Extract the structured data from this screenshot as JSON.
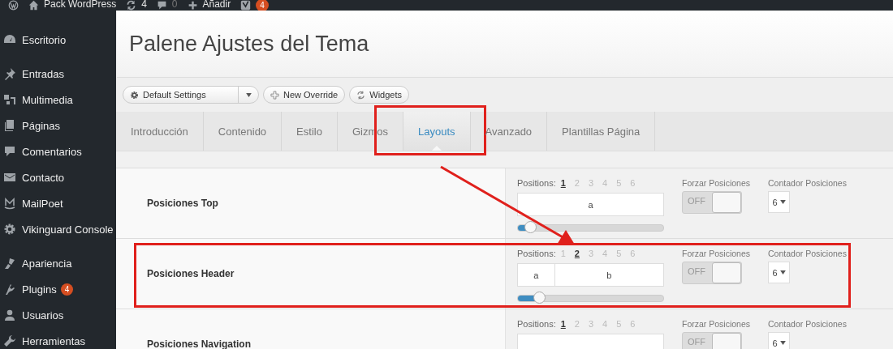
{
  "admin_bar": {
    "site": "Pack WordPress",
    "updates": "4",
    "comments": "0",
    "add": "Añadir",
    "seo_badge": "4"
  },
  "sidebar": {
    "groups": [
      {
        "items": [
          {
            "label": "Escritorio",
            "kind": "dashboard"
          }
        ]
      },
      {
        "items": [
          {
            "label": "Entradas",
            "kind": "pin"
          },
          {
            "label": "Multimedia",
            "kind": "media"
          },
          {
            "label": "Páginas",
            "kind": "pages"
          },
          {
            "label": "Comentarios",
            "kind": "comment"
          },
          {
            "label": "Contacto",
            "kind": "mail"
          },
          {
            "label": "MailPoet",
            "kind": "mailpoet"
          },
          {
            "label": "Vikinguard Console",
            "kind": "gear"
          }
        ]
      },
      {
        "items": [
          {
            "label": "Apariencia",
            "kind": "brush"
          },
          {
            "label": "Plugins",
            "kind": "plug",
            "badge": "4"
          },
          {
            "label": "Usuarios",
            "kind": "user"
          },
          {
            "label": "Herramientas",
            "kind": "wrench"
          }
        ]
      }
    ]
  },
  "page_title": "Palene Ajustes del Tema",
  "toolbar": {
    "preset": "Default Settings",
    "buttons": [
      {
        "label": "New Override",
        "kind": "plus"
      },
      {
        "label": "Widgets",
        "kind": "refresh"
      }
    ]
  },
  "tabs": [
    {
      "label": "Introducción",
      "selected": false,
      "highlighted": false
    },
    {
      "label": "Contenido",
      "selected": false,
      "highlighted": false
    },
    {
      "label": "Estilo",
      "selected": false,
      "highlighted": false
    },
    {
      "label": "Gizmos",
      "selected": false,
      "highlighted": false
    },
    {
      "label": "Layouts",
      "selected": true,
      "highlighted": true
    },
    {
      "label": "Avanzado",
      "selected": false,
      "highlighted": false
    },
    {
      "label": "Plantillas Página",
      "selected": false,
      "highlighted": false
    }
  ],
  "annotation_arrow": true,
  "rows": [
    {
      "label": "Posiciones Top",
      "highlighted": false,
      "positions_label": "Positions:",
      "positions": [
        {
          "label": "1",
          "selected": true
        },
        {
          "label": "2",
          "selected": false
        },
        {
          "label": "3",
          "selected": false
        },
        {
          "label": "4",
          "selected": false
        },
        {
          "label": "5",
          "selected": false
        },
        {
          "label": "6",
          "selected": false
        }
      ],
      "segments": [
        "a"
      ],
      "level": 0.09,
      "force_label": "Forzar Posiciones",
      "force_text": "OFF",
      "force_on": false,
      "counter_label": "Contador Posiciones",
      "counter": "6"
    },
    {
      "label": "Posiciones Header",
      "highlighted": true,
      "positions_label": "Positions:",
      "positions": [
        {
          "label": "1",
          "selected": false
        },
        {
          "label": "2",
          "selected": true
        },
        {
          "label": "3",
          "selected": false
        },
        {
          "label": "4",
          "selected": false
        },
        {
          "label": "5",
          "selected": false
        },
        {
          "label": "6",
          "selected": false
        }
      ],
      "segments": [
        "a",
        "b"
      ],
      "level": 0.15,
      "force_label": "Forzar Posiciones",
      "force_text": "OFF",
      "force_on": false,
      "counter_label": "Contador Posiciones",
      "counter": "6"
    },
    {
      "label": "Posiciones Navigation",
      "highlighted": false,
      "positions_label": "Positions:",
      "positions": [
        {
          "label": "1",
          "selected": true
        },
        {
          "label": "2",
          "selected": false
        },
        {
          "label": "3",
          "selected": false
        },
        {
          "label": "4",
          "selected": false
        },
        {
          "label": "5",
          "selected": false
        },
        {
          "label": "6",
          "selected": false
        }
      ],
      "segments": [],
      "force_label": "Forzar Posiciones",
      "force_text": "OFF",
      "force_on": false,
      "counter_label": "Contador Posiciones",
      "counter": "6"
    }
  ]
}
